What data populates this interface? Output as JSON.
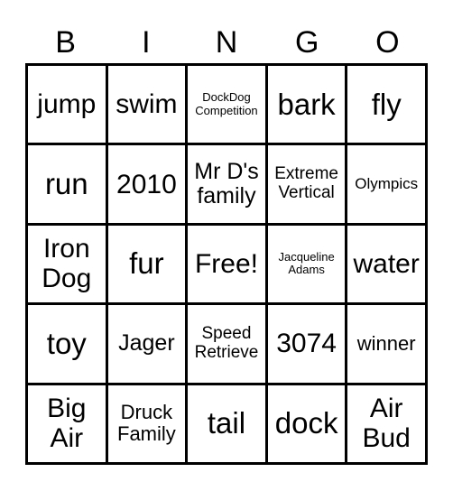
{
  "header": {
    "letters": [
      "B",
      "I",
      "N",
      "G",
      "O"
    ]
  },
  "card": {
    "rows": [
      [
        {
          "text": "jump",
          "size": "l"
        },
        {
          "text": "swim",
          "size": "l"
        },
        {
          "text": "DockDog\nCompetition",
          "size": "xxs"
        },
        {
          "text": "bark",
          "size": "xl"
        },
        {
          "text": "fly",
          "size": "xl"
        }
      ],
      [
        {
          "text": "run",
          "size": "xl"
        },
        {
          "text": "2010",
          "size": "l"
        },
        {
          "text": "Mr D's\nfamily",
          "size": "m"
        },
        {
          "text": "Extreme\nVertical",
          "size": "s"
        },
        {
          "text": "Olympics",
          "size": "xs"
        }
      ],
      [
        {
          "text": "Iron\nDog",
          "size": "l"
        },
        {
          "text": "fur",
          "size": "xl"
        },
        {
          "text": "Free!",
          "size": "l"
        },
        {
          "text": "Jacqueline\nAdams",
          "size": "xxs"
        },
        {
          "text": "water",
          "size": "l"
        }
      ],
      [
        {
          "text": "toy",
          "size": "xl"
        },
        {
          "text": "Jager",
          "size": "m"
        },
        {
          "text": "Speed\nRetrieve",
          "size": "s"
        },
        {
          "text": "3074",
          "size": "l"
        },
        {
          "text": "winner",
          "size": "ms"
        }
      ],
      [
        {
          "text": "Big\nAir",
          "size": "l"
        },
        {
          "text": "Druck\nFamily",
          "size": "ms"
        },
        {
          "text": "tail",
          "size": "xl"
        },
        {
          "text": "dock",
          "size": "xl"
        },
        {
          "text": "Air\nBud",
          "size": "l"
        }
      ]
    ]
  }
}
